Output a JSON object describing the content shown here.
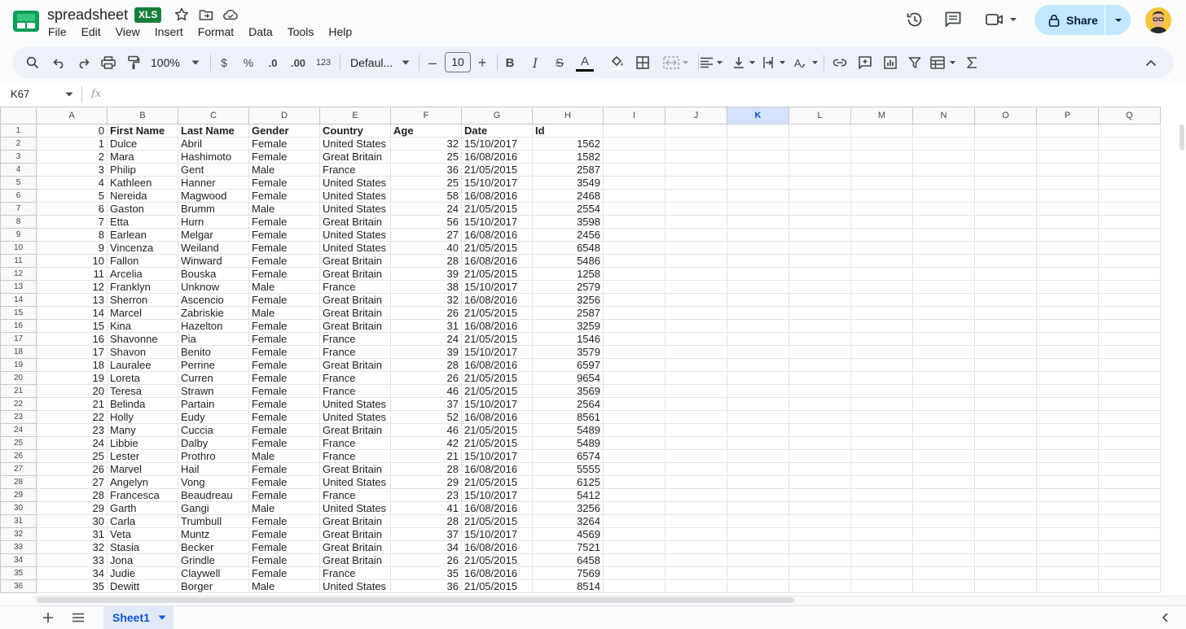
{
  "window": {
    "doc_title": "spreadsheet",
    "file_badge": "XLS"
  },
  "menu": [
    "File",
    "Edit",
    "View",
    "Insert",
    "Format",
    "Data",
    "Tools",
    "Help"
  ],
  "share": {
    "label": "Share"
  },
  "toolbar": {
    "zoom": "100%",
    "currency": "$",
    "percent": "%",
    "decrease_decimal": ".0",
    "increase_decimal": ".00",
    "number_format": "123",
    "font": "Defaul...",
    "font_size": "10",
    "minus": "–",
    "plus": "+",
    "bold": "B",
    "italic": "I",
    "strike": "S",
    "text_color": "A"
  },
  "formula_bar": {
    "name_box": "K67",
    "fx": "fx",
    "formula": ""
  },
  "grid": {
    "columns": [
      "A",
      "B",
      "C",
      "D",
      "E",
      "F",
      "G",
      "H",
      "I",
      "J",
      "K",
      "L",
      "M",
      "N",
      "O",
      "P",
      "Q"
    ],
    "selected_column": "K",
    "rows": [
      [
        "0",
        "First Name",
        "Last Name",
        "Gender",
        "Country",
        "Age",
        "Date",
        "Id"
      ],
      [
        "1",
        "Dulce",
        "Abril",
        "Female",
        "United States",
        "32",
        "15/10/2017",
        "1562"
      ],
      [
        "2",
        "Mara",
        "Hashimoto",
        "Female",
        "Great Britain",
        "25",
        "16/08/2016",
        "1582"
      ],
      [
        "3",
        "Philip",
        "Gent",
        "Male",
        "France",
        "36",
        "21/05/2015",
        "2587"
      ],
      [
        "4",
        "Kathleen",
        "Hanner",
        "Female",
        "United States",
        "25",
        "15/10/2017",
        "3549"
      ],
      [
        "5",
        "Nereida",
        "Magwood",
        "Female",
        "United States",
        "58",
        "16/08/2016",
        "2468"
      ],
      [
        "6",
        "Gaston",
        "Brumm",
        "Male",
        "United States",
        "24",
        "21/05/2015",
        "2554"
      ],
      [
        "7",
        "Etta",
        "Hurn",
        "Female",
        "Great Britain",
        "56",
        "15/10/2017",
        "3598"
      ],
      [
        "8",
        "Earlean",
        "Melgar",
        "Female",
        "United States",
        "27",
        "16/08/2016",
        "2456"
      ],
      [
        "9",
        "Vincenza",
        "Weiland",
        "Female",
        "United States",
        "40",
        "21/05/2015",
        "6548"
      ],
      [
        "10",
        "Fallon",
        "Winward",
        "Female",
        "Great Britain",
        "28",
        "16/08/2016",
        "5486"
      ],
      [
        "11",
        "Arcelia",
        "Bouska",
        "Female",
        "Great Britain",
        "39",
        "21/05/2015",
        "1258"
      ],
      [
        "12",
        "Franklyn",
        "Unknow",
        "Male",
        "France",
        "38",
        "15/10/2017",
        "2579"
      ],
      [
        "13",
        "Sherron",
        "Ascencio",
        "Female",
        "Great Britain",
        "32",
        "16/08/2016",
        "3256"
      ],
      [
        "14",
        "Marcel",
        "Zabriskie",
        "Male",
        "Great Britain",
        "26",
        "21/05/2015",
        "2587"
      ],
      [
        "15",
        "Kina",
        "Hazelton",
        "Female",
        "Great Britain",
        "31",
        "16/08/2016",
        "3259"
      ],
      [
        "16",
        "Shavonne",
        "Pia",
        "Female",
        "France",
        "24",
        "21/05/2015",
        "1546"
      ],
      [
        "17",
        "Shavon",
        "Benito",
        "Female",
        "France",
        "39",
        "15/10/2017",
        "3579"
      ],
      [
        "18",
        "Lauralee",
        "Perrine",
        "Female",
        "Great Britain",
        "28",
        "16/08/2016",
        "6597"
      ],
      [
        "19",
        "Loreta",
        "Curren",
        "Female",
        "France",
        "26",
        "21/05/2015",
        "9654"
      ],
      [
        "20",
        "Teresa",
        "Strawn",
        "Female",
        "France",
        "46",
        "21/05/2015",
        "3569"
      ],
      [
        "21",
        "Belinda",
        "Partain",
        "Female",
        "United States",
        "37",
        "15/10/2017",
        "2564"
      ],
      [
        "22",
        "Holly",
        "Eudy",
        "Female",
        "United States",
        "52",
        "16/08/2016",
        "8561"
      ],
      [
        "23",
        "Many",
        "Cuccia",
        "Female",
        "Great Britain",
        "46",
        "21/05/2015",
        "5489"
      ],
      [
        "24",
        "Libbie",
        "Dalby",
        "Female",
        "France",
        "42",
        "21/05/2015",
        "5489"
      ],
      [
        "25",
        "Lester",
        "Prothro",
        "Male",
        "France",
        "21",
        "15/10/2017",
        "6574"
      ],
      [
        "26",
        "Marvel",
        "Hail",
        "Female",
        "Great Britain",
        "28",
        "16/08/2016",
        "5555"
      ],
      [
        "27",
        "Angelyn",
        "Vong",
        "Female",
        "United States",
        "29",
        "21/05/2015",
        "6125"
      ],
      [
        "28",
        "Francesca",
        "Beaudreau",
        "Female",
        "France",
        "23",
        "15/10/2017",
        "5412"
      ],
      [
        "29",
        "Garth",
        "Gangi",
        "Male",
        "United States",
        "41",
        "16/08/2016",
        "3256"
      ],
      [
        "30",
        "Carla",
        "Trumbull",
        "Female",
        "Great Britain",
        "28",
        "21/05/2015",
        "3264"
      ],
      [
        "31",
        "Veta",
        "Muntz",
        "Female",
        "Great Britain",
        "37",
        "15/10/2017",
        "4569"
      ],
      [
        "32",
        "Stasia",
        "Becker",
        "Female",
        "Great Britain",
        "34",
        "16/08/2016",
        "7521"
      ],
      [
        "33",
        "Jona",
        "Grindle",
        "Female",
        "Great Britain",
        "26",
        "21/05/2015",
        "6458"
      ],
      [
        "34",
        "Judie",
        "Claywell",
        "Female",
        "France",
        "35",
        "16/08/2016",
        "7569"
      ],
      [
        "35",
        "Dewitt",
        "Borger",
        "Male",
        "United States",
        "36",
        "21/05/2015",
        "8514"
      ]
    ]
  },
  "sheets": [
    {
      "name": "Sheet1",
      "active": true
    }
  ],
  "colors": {
    "accent": "#0b57d0",
    "share_bg": "#c2e7ff",
    "badge_green": "#188038",
    "toolbar_bg": "#edf2fa",
    "selected_header": "#d3e3fd"
  }
}
